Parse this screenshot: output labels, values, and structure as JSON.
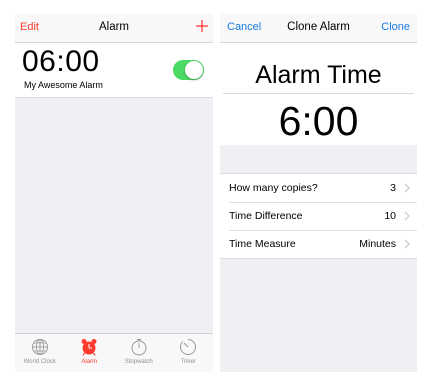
{
  "colors": {
    "ios_red": "#ff3b30",
    "ios_blue": "#1a7ae2",
    "toggle_green": "#4cd964",
    "tab_gray": "#929292"
  },
  "alarm_screen": {
    "nav": {
      "edit_label": "Edit",
      "title": "Alarm",
      "add_icon": "plus-icon"
    },
    "alarm": {
      "time": "06:00",
      "name": "My Awesome Alarm",
      "enabled": true
    },
    "tabs": [
      {
        "label": "World Clock",
        "icon": "globe-icon",
        "active": false
      },
      {
        "label": "Alarm",
        "icon": "alarm-clock-icon",
        "active": true
      },
      {
        "label": "Stopwatch",
        "icon": "stopwatch-icon",
        "active": false
      },
      {
        "label": "Timer",
        "icon": "timer-icon",
        "active": false
      }
    ]
  },
  "clone_screen": {
    "nav": {
      "cancel_label": "Cancel",
      "title": "Clone Alarm",
      "clone_label": "Clone"
    },
    "header": {
      "title": "Alarm Time",
      "time": "6:00"
    },
    "settings": [
      {
        "label": "How many copies?",
        "value": "3"
      },
      {
        "label": "Time Difference",
        "value": "10"
      },
      {
        "label": "Time Measure",
        "value": "Minutes"
      }
    ]
  }
}
